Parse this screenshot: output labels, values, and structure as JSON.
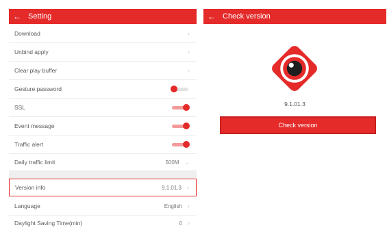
{
  "colors": {
    "accent": "#e52a2a",
    "toggle_on_track": "#f39a9a",
    "toggle_off_track": "#e3e3e3"
  },
  "setting": {
    "title": "Setting",
    "back_icon": "arrow-left-icon",
    "rows": [
      {
        "label": "Download",
        "type": "nav"
      },
      {
        "label": "Unbind apply",
        "type": "nav"
      },
      {
        "label": "Clear play buffer",
        "type": "nav"
      },
      {
        "label": "Gesture password",
        "type": "toggle",
        "on": false
      },
      {
        "label": "SSL",
        "type": "toggle",
        "on": true
      },
      {
        "label": "Event message",
        "type": "toggle",
        "on": true
      },
      {
        "label": "Traffic alert",
        "type": "toggle",
        "on": true
      },
      {
        "label": "Daily traffic limit",
        "type": "select",
        "value": "500M"
      },
      {
        "label": "Version info",
        "type": "nav",
        "value": "9.1.01.3",
        "highlighted": true
      },
      {
        "label": "Language",
        "type": "nav",
        "value": "English"
      },
      {
        "label": "Daylight Saving Time(min)",
        "type": "nav",
        "value": "0"
      }
    ]
  },
  "check_version": {
    "title": "Check version",
    "back_icon": "arrow-left-icon",
    "logo_icon": "camera-eye-logo-icon",
    "version": "9.1.01.3",
    "button_label": "Check version"
  }
}
